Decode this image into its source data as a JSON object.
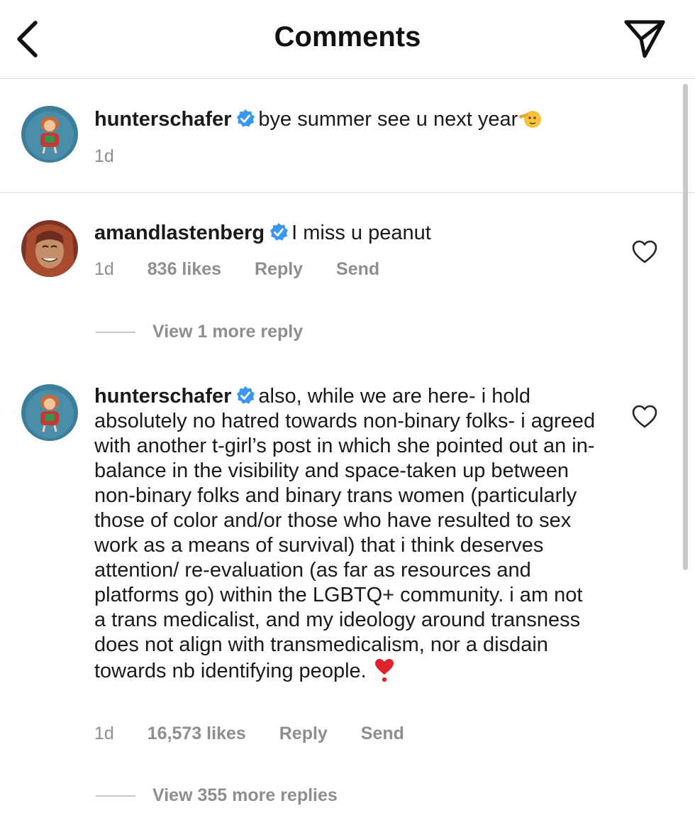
{
  "header": {
    "title": "Comments",
    "back_icon": "chevron-left-icon",
    "share_icon": "paper-plane-icon"
  },
  "caption": {
    "username": "hunterschafer",
    "verified": true,
    "text": "bye summer see u next year",
    "emoji": "saluting-face-icon",
    "time": "1d"
  },
  "comments": [
    {
      "username": "amandlastenberg",
      "verified": true,
      "text": "I miss u peanut",
      "time": "1d",
      "likes": "836 likes",
      "reply_label": "Reply",
      "send_label": "Send",
      "view_replies": "View 1 more reply"
    },
    {
      "username": "hunterschafer",
      "verified": true,
      "text": "also, while we are here- i hold absolutely no hatred towards non-binary folks- i agreed with another t-girl’s post in which she pointed out an in-balance in the visibility and space-taken up between non-binary folks and binary trans women (particularly those of color and/or those who have resulted to sex work as a means of survival) that i think deserves attention/ re-evaluation (as far as resources and platforms go) within the LGBTQ+ community. i am not a trans medicalist, and my ideology around transness does not align with transmedicalism, nor a disdain towards nb identifying people.",
      "emoji": "red-heart-icon",
      "time": "1d",
      "likes": "16,573 likes",
      "reply_label": "Reply",
      "send_label": "Send",
      "view_replies": "View 355 more replies"
    }
  ],
  "colors": {
    "verified_blue": "#3897f0",
    "meta_gray": "#8e8e8e",
    "divider": "#dcdcdc"
  }
}
